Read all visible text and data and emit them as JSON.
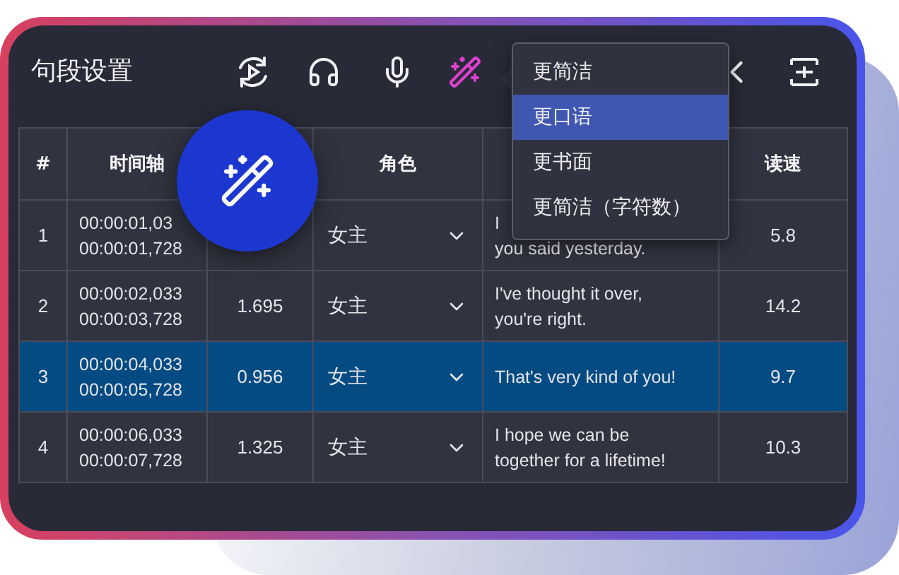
{
  "title": "句段设置",
  "toolbar": [
    {
      "kind": "replay",
      "selected": false
    },
    {
      "kind": "headphones",
      "selected": false
    },
    {
      "kind": "mic",
      "selected": false
    },
    {
      "kind": "wand",
      "selected": true
    },
    {
      "kind": "chevron",
      "selected": false
    },
    {
      "kind": "insert",
      "selected": false
    }
  ],
  "menu": [
    {
      "label": "更简洁",
      "selected": false
    },
    {
      "label": "更口语",
      "selected": true
    },
    {
      "label": "更书面",
      "selected": false
    },
    {
      "label": "更简洁（字符数）",
      "selected": false
    }
  ],
  "columns": [
    {
      "label": "#"
    },
    {
      "label": "时间轴"
    },
    {},
    {
      "label": "角色"
    },
    {},
    {
      "label": "读速"
    }
  ],
  "rows": [
    {
      "index": "1",
      "time": [
        "00:00:01,03",
        "00:00:01,728"
      ],
      "role": "女主",
      "text": [
        "I",
        "you said yesterday."
      ],
      "speed": "5.8",
      "selected": false
    },
    {
      "index": "2",
      "time": [
        "00:00:02,033",
        "00:00:03,728"
      ],
      "duration": "1.695",
      "role": "女主",
      "text": [
        "I've thought it over,",
        "you're right."
      ],
      "speed": "14.2",
      "selected": false
    },
    {
      "index": "3",
      "time": [
        "00:00:04,033",
        "00:00:05,728"
      ],
      "duration": "0.956",
      "role": "女主",
      "text": [
        "That's very kind of you!"
      ],
      "speed": "9.7",
      "selected": true
    },
    {
      "index": "4",
      "time": [
        "00:00:06,033",
        "00:00:07,728"
      ],
      "duration": "1.325",
      "role": "女主",
      "text": [
        "I hope we can be",
        "together for a lifetime!"
      ],
      "speed": "10.3",
      "selected": false
    }
  ],
  "fab": {
    "kind": "wand"
  }
}
